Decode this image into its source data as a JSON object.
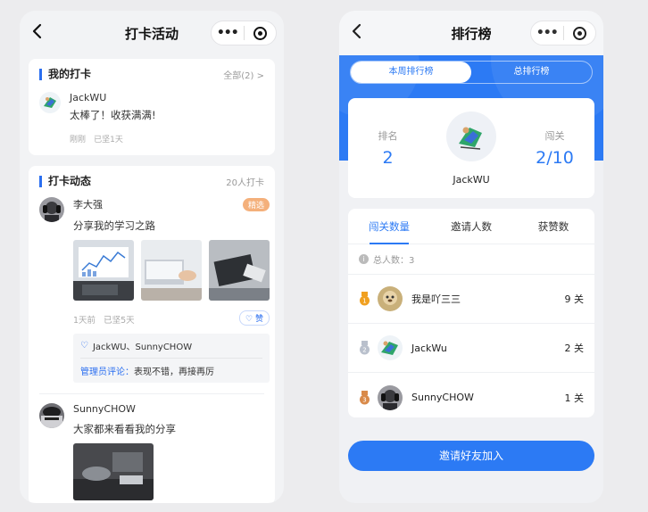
{
  "left": {
    "nav": {
      "title": "打卡活动"
    },
    "my_checkin": {
      "title": "我的打卡",
      "all_link": "全部(2) >",
      "user": "JackWU",
      "text": "太棒了！收获满满!",
      "time": "刚刚",
      "days": "已坚1天"
    },
    "feed": {
      "title": "打卡动态",
      "count": "20人打卡",
      "items": [
        {
          "user": "李大强",
          "tag": "精选",
          "text": "分享我的学习之路",
          "time": "1天前",
          "days": "已坚5天",
          "like": "赞",
          "likes_by": "JackWU、SunnyCHOW",
          "admin_label": "管理员评论：",
          "admin_comment": "表现不错，再接再厉"
        },
        {
          "user": "SunnyCHOW",
          "text": "大家都来看看我的分享"
        }
      ]
    }
  },
  "right": {
    "nav": {
      "title": "排行榜"
    },
    "tabs": {
      "weekly": "本周排行榜",
      "total": "总排行榜"
    },
    "me": {
      "rank_label": "排名",
      "rank": "2",
      "name": "JackWU",
      "level_label": "闯关",
      "level": "2/10"
    },
    "board": {
      "tabs": [
        "闯关数量",
        "邀请人数",
        "获赞数"
      ],
      "total": "总人数：3",
      "rows": [
        {
          "name": "我是吖三三",
          "value": "9 关",
          "medal_color": "#f0a020"
        },
        {
          "name": "JackWu",
          "value": "2 关",
          "medal_color": "#b9c0cc"
        },
        {
          "name": "SunnyCHOW",
          "value": "1 关",
          "medal_color": "#d98a4a"
        }
      ]
    },
    "invite_button": "邀请好友加入"
  },
  "colors": {
    "accent": "#2c7af4",
    "tag": "#f4b07b",
    "background": "#ececee"
  }
}
